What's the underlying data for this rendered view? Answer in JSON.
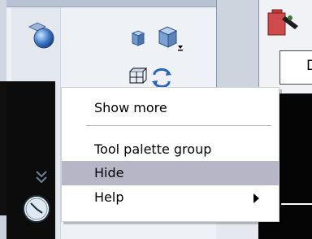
{
  "context_menu": {
    "items": [
      {
        "label": "Show more"
      },
      {
        "label": "Tool palette group",
        "has_submenu": true
      },
      {
        "label": "Hide",
        "highlighted": true
      },
      {
        "label": "Help"
      }
    ]
  },
  "drawing_tab": {
    "label": "D"
  },
  "colors": {
    "highlight": "#b6b6c6",
    "canvas": "#050505",
    "palette_bg": "#eef1f6"
  },
  "icons": [
    "sphere-icon",
    "box-icon",
    "box-dropdown-icon",
    "grid-icon",
    "refresh-icon",
    "chevrons-down-icon",
    "clock-icon",
    "pencil-icon"
  ]
}
